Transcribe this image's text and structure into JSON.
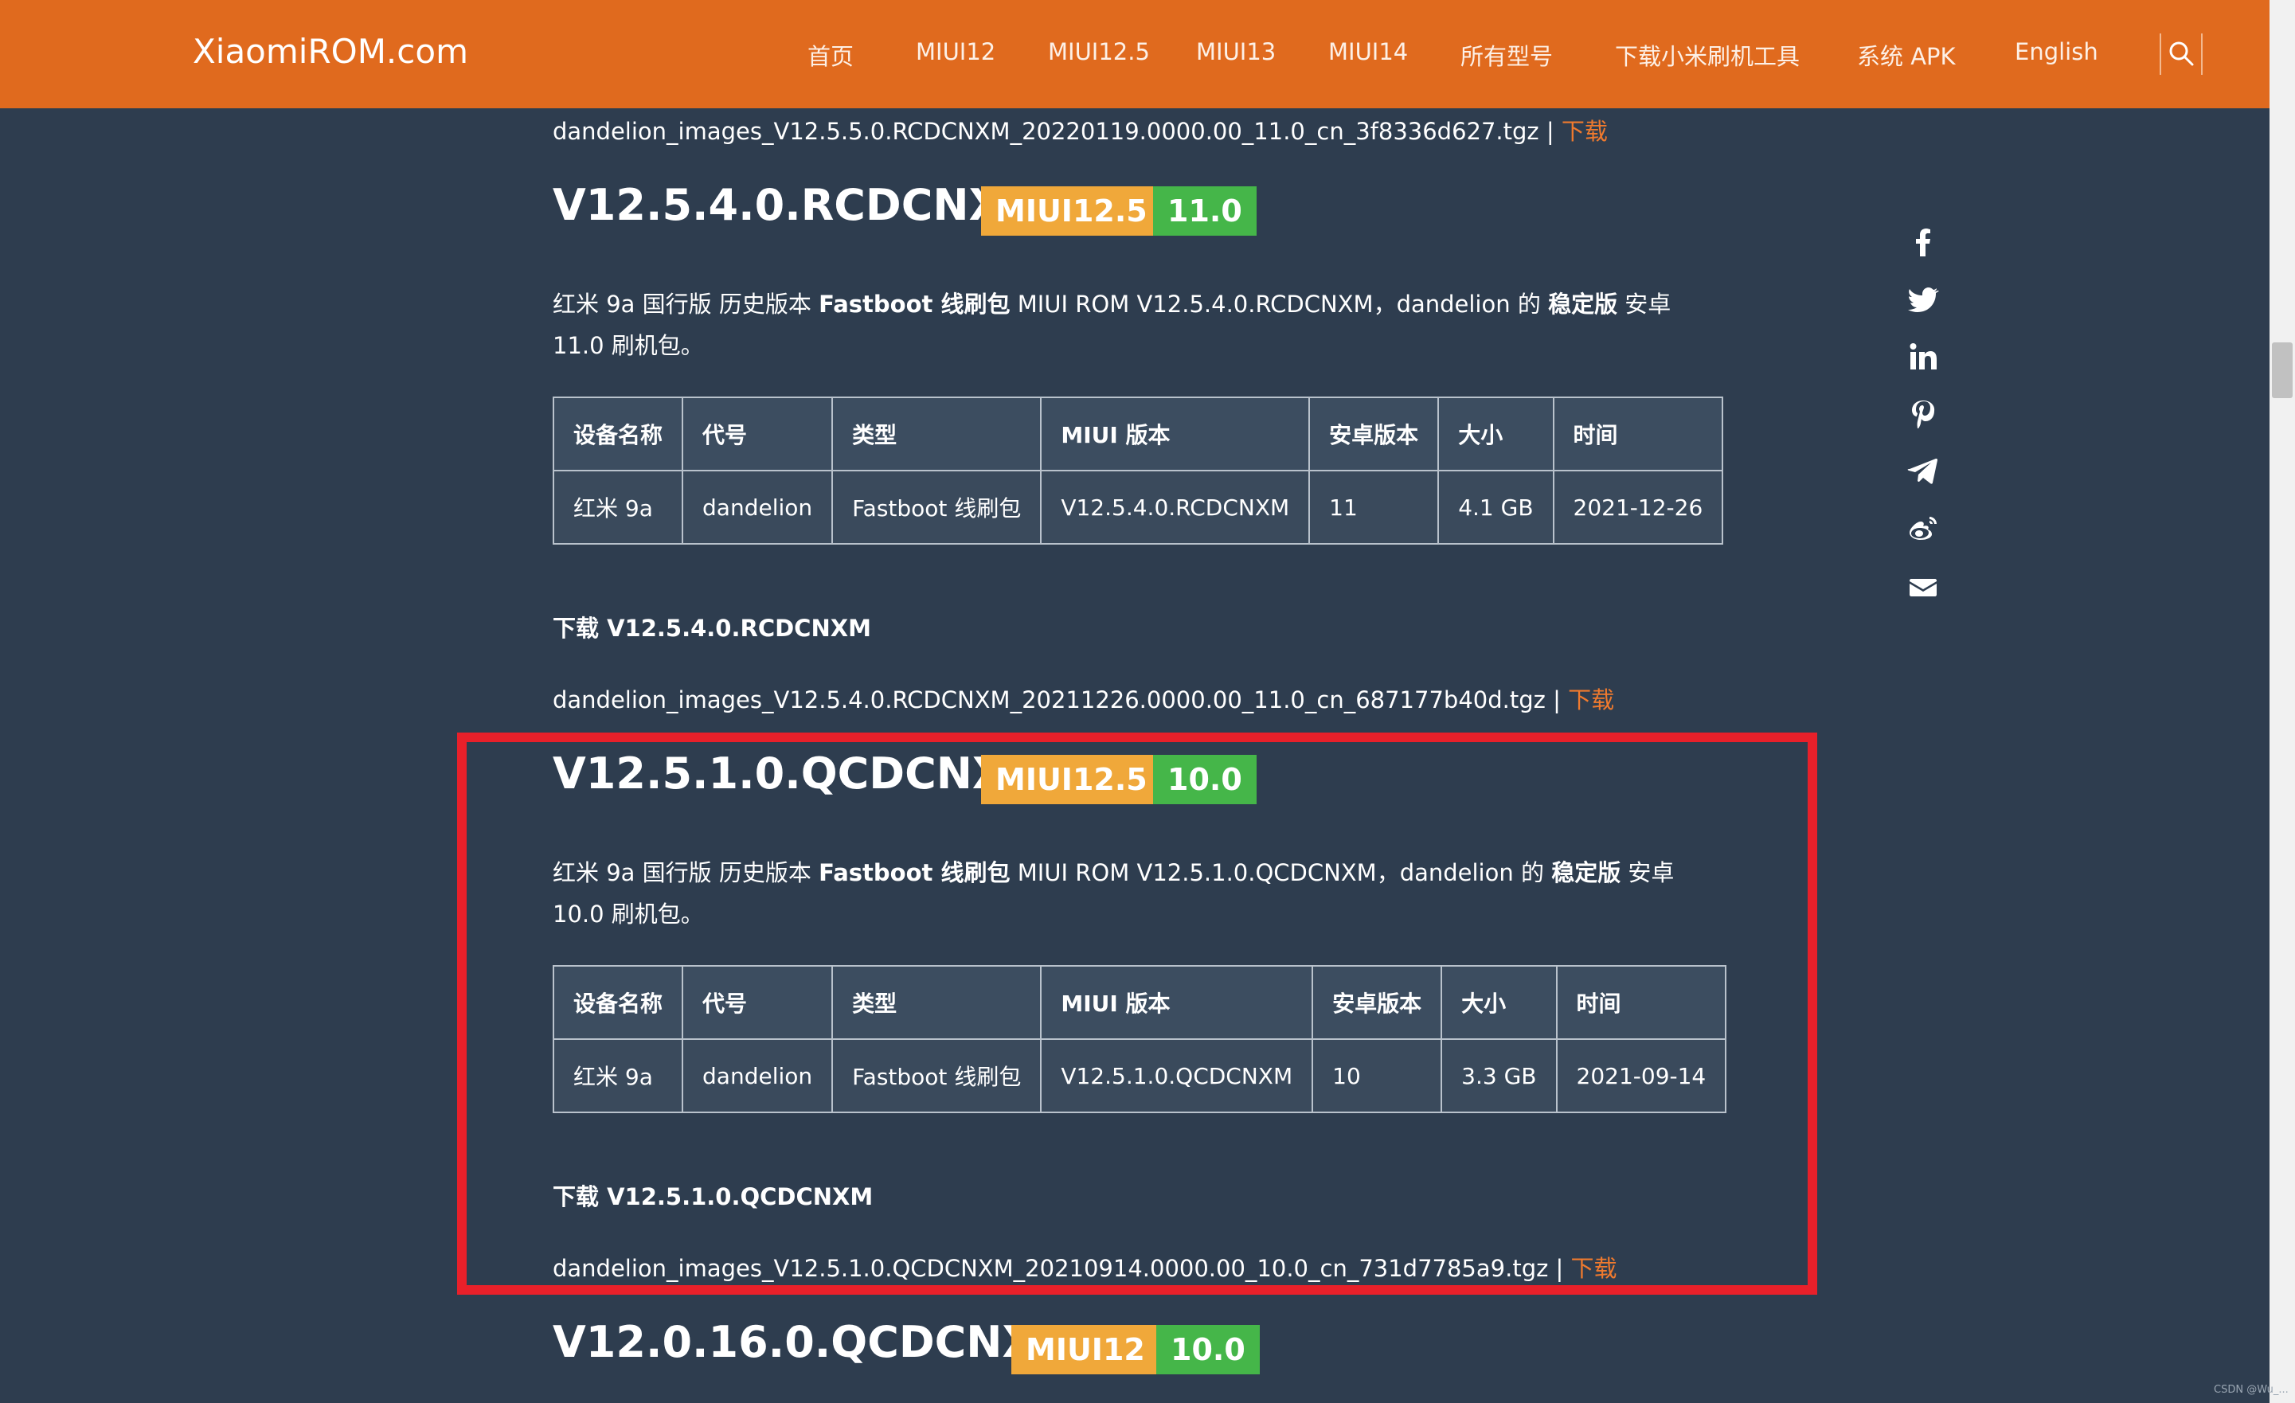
{
  "header": {
    "brand": "XiaomiROM.com",
    "nav": [
      "首页",
      "MIUI12",
      "MIUI12.5",
      "MIUI13",
      "MIUI14",
      "所有型号",
      "下载小米刷机工具",
      "系统 APK",
      "English"
    ],
    "search_icon": "search-icon",
    "color": "#e06a1e"
  },
  "top_file": {
    "name": "dandelion_images_V12.5.5.0.RCDCNXM_20220119.0000.00_11.0_cn_3f8336d627.tgz",
    "sep": " | ",
    "link": "下载"
  },
  "social": [
    "facebook-icon",
    "twitter-icon",
    "linkedin-icon",
    "pinterest-icon",
    "telegram-icon",
    "weibo-icon",
    "email-icon"
  ],
  "table_headers": [
    "设备名称",
    "代号",
    "类型",
    "MIUI 版本",
    "安卓版本",
    "大小",
    "时间"
  ],
  "releases": [
    {
      "version": "V12.5.4.0.RCDCNXM",
      "miui": "MIUI12.5",
      "android": "11.0",
      "desc_pre": "红米 9a 国行版 历史版本 ",
      "desc_b1": "Fastboot 线刷包",
      "desc_mid": " MIUI ROM V12.5.4.0.RCDCNXM，dandelion 的 ",
      "desc_b2": "稳定版",
      "desc_post": " 安卓 11.0 刷机包。",
      "row": [
        "红米 9a",
        "dandelion",
        "Fastboot 线刷包",
        "V12.5.4.0.RCDCNXM",
        "11",
        "4.1 GB",
        "2021-12-26"
      ],
      "download_heading": "下载 V12.5.4.0.RCDCNXM",
      "file": "dandelion_images_V12.5.4.0.RCDCNXM_20211226.0000.00_11.0_cn_687177b40d.tgz",
      "sep": " | ",
      "link": "下载"
    },
    {
      "version": "V12.5.1.0.QCDCNXM",
      "miui": "MIUI12.5",
      "android": "10.0",
      "desc_pre": "红米 9a 国行版 历史版本 ",
      "desc_b1": "Fastboot 线刷包",
      "desc_mid": " MIUI ROM V12.5.1.0.QCDCNXM，dandelion 的 ",
      "desc_b2": "稳定版",
      "desc_post": " 安卓 10.0 刷机包。",
      "row": [
        "红米 9a",
        "dandelion",
        "Fastboot 线刷包",
        "V12.5.1.0.QCDCNXM",
        "10",
        "3.3 GB",
        "2021-09-14"
      ],
      "download_heading": "下载 V12.5.1.0.QCDCNXM",
      "file": "dandelion_images_V12.5.1.0.QCDCNXM_20210914.0000.00_10.0_cn_731d7785a9.tgz",
      "sep": " | ",
      "link": "下载"
    },
    {
      "version": "V12.0.16.0.QCDCNXM",
      "miui": "MIUI12",
      "android": "10.0"
    }
  ],
  "colors": {
    "background": "#2e3d4f",
    "accent": "#e06a1e",
    "miui_badge": "#f0a83a",
    "android_badge": "#45b649",
    "highlight": "#e8202a",
    "link": "#f07a2e"
  },
  "watermark": "CSDN @Wu_..."
}
